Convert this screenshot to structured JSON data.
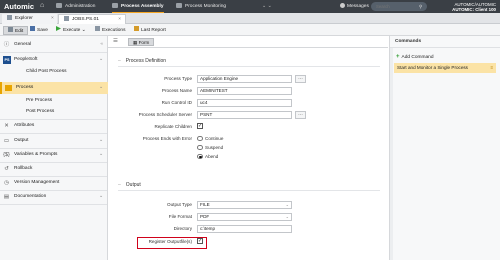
{
  "topbar": {
    "logo": "Automic",
    "nav": [
      {
        "label": "Administration"
      },
      {
        "label": "Process Assembly"
      },
      {
        "label": "Process Monitoring"
      }
    ],
    "more": "⌄ ⌄",
    "messages": "Messages",
    "search_placeholder": "Search",
    "user_line1": "AUTOMIC/AUTOMIC",
    "user_line2": "AUTOMIC: Client 100"
  },
  "tabs": {
    "explorer": "Explorer",
    "object": "JOBS.PS.01"
  },
  "toolbar": {
    "edit": "Edit",
    "save": "Save",
    "execute": "Execute",
    "executions": "Executions",
    "last_report": "Last Report"
  },
  "sidebar": {
    "general": "General",
    "peoplesoft": "PeopleSoft",
    "post_process_child": "Child Post Process",
    "process": "Process",
    "pre_process": "Pre Process",
    "post_process": "Post Process",
    "attributes": "Attributes",
    "output": "Output",
    "variables": "Variables & Prompts",
    "rollback": "Rollback",
    "version_mgmt": "Version Management",
    "documentation": "Documentation"
  },
  "center": {
    "form_tab": "Form",
    "section_process": "Process Definition",
    "section_output": "Output",
    "fields": {
      "process_type": {
        "label": "Process Type",
        "value": "Application Engine"
      },
      "process_name": {
        "label": "Process Name",
        "value": "AEMINITEST"
      },
      "run_control": {
        "label": "Run Control ID",
        "value": "uc4"
      },
      "scheduler": {
        "label": "Process Scheduler Server",
        "value": "PSNT"
      },
      "replicate": {
        "label": "Replicate Children",
        "checked": true
      },
      "process_ends": {
        "label": "Process Ends with Error"
      },
      "output_type": {
        "label": "Output Type",
        "value": "FILE"
      },
      "file_format": {
        "label": "File Format",
        "value": "PDF"
      },
      "directory": {
        "label": "Directory",
        "value": "c:\\temp"
      },
      "register": {
        "label": "Register Outputfile(s)",
        "checked": true
      }
    },
    "error_options": [
      "Continue",
      "Suspend",
      "Abend"
    ],
    "error_selected": "Abend"
  },
  "right": {
    "header": "Commands",
    "add": "Add Command",
    "command": "Start and Monitor a Single Process"
  }
}
